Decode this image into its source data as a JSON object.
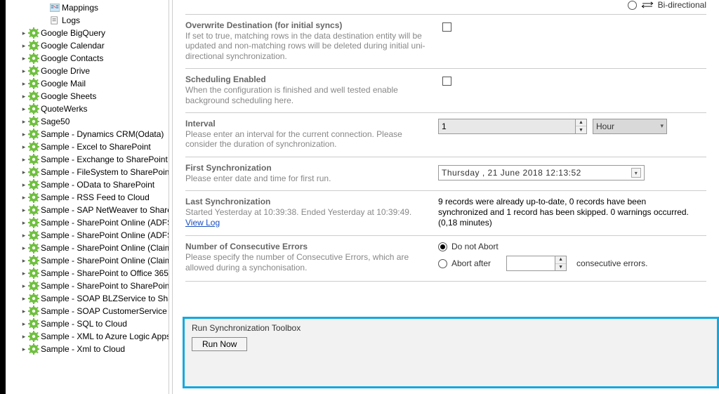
{
  "tree": {
    "sub_items": [
      {
        "label": "Mappings",
        "icon": "mappings"
      },
      {
        "label": "Logs",
        "icon": "logs"
      }
    ],
    "items": [
      "Google BigQuery",
      "Google Calendar",
      "Google Contacts",
      "Google Drive",
      "Google Mail",
      "Google Sheets",
      "QuoteWerks",
      "Sage50",
      "Sample - Dynamics CRM(Odata)",
      "Sample - Excel to SharePoint",
      "Sample - Exchange to SharePoint",
      "Sample - FileSystem to SharePoint",
      "Sample - OData to SharePoint",
      "Sample - RSS Feed to Cloud",
      "Sample - SAP NetWeaver to SharePoint",
      "Sample - SharePoint Online (ADFS)",
      "Sample - SharePoint Online (ADFS)",
      "Sample - SharePoint Online (Claims)",
      "Sample - SharePoint Online (Claims)",
      "Sample - SharePoint to Office 365",
      "Sample - SharePoint to SharePoint",
      "Sample - SOAP BLZService to SharePoint",
      "Sample - SOAP CustomerService",
      "Sample - SQL to Cloud",
      "Sample - XML to Azure Logic Apps",
      "Sample - Xml to Cloud"
    ]
  },
  "bidirectional_label": "Bi-directional",
  "overwrite": {
    "title": "Overwrite Destination (for initial syncs)",
    "desc": "If set to true, matching rows in the data destination entity will be updated and non-matching rows will be deleted during initial uni-directional synchronization."
  },
  "scheduling": {
    "title": "Scheduling Enabled",
    "desc": "When the configuration is finished and well tested enable background scheduling here."
  },
  "interval": {
    "title": "Interval",
    "desc": "Please enter an interval for the current connection. Please consider the duration of synchronization.",
    "value": "1",
    "unit": "Hour"
  },
  "first_sync": {
    "title": "First Synchronization",
    "desc": "Please enter date and time for first run.",
    "value": "Thursday  ,  21       June      2018 12:13:52"
  },
  "last_sync": {
    "title": "Last Synchronization",
    "desc_prefix": "Started  Yesterday at 10:39:38. Ended Yesterday at 10:39:49.",
    "view_log": "View Log",
    "result": "9 records were already up-to-date, 0 records have been synchronized and 1 record has been skipped. 0 warnings occurred. (0,18 minutes)"
  },
  "errors": {
    "title": "Number of Consecutive Errors",
    "desc": "Please specify the number of Consecutive Errors, which are allowed during a synchonisation.",
    "opt_do_not_abort": "Do not Abort",
    "opt_abort_after": "Abort after",
    "suffix": "consecutive errors.",
    "abort_value": ""
  },
  "toolbox": {
    "title": "Run Synchronization Toolbox",
    "button": "Run Now"
  }
}
